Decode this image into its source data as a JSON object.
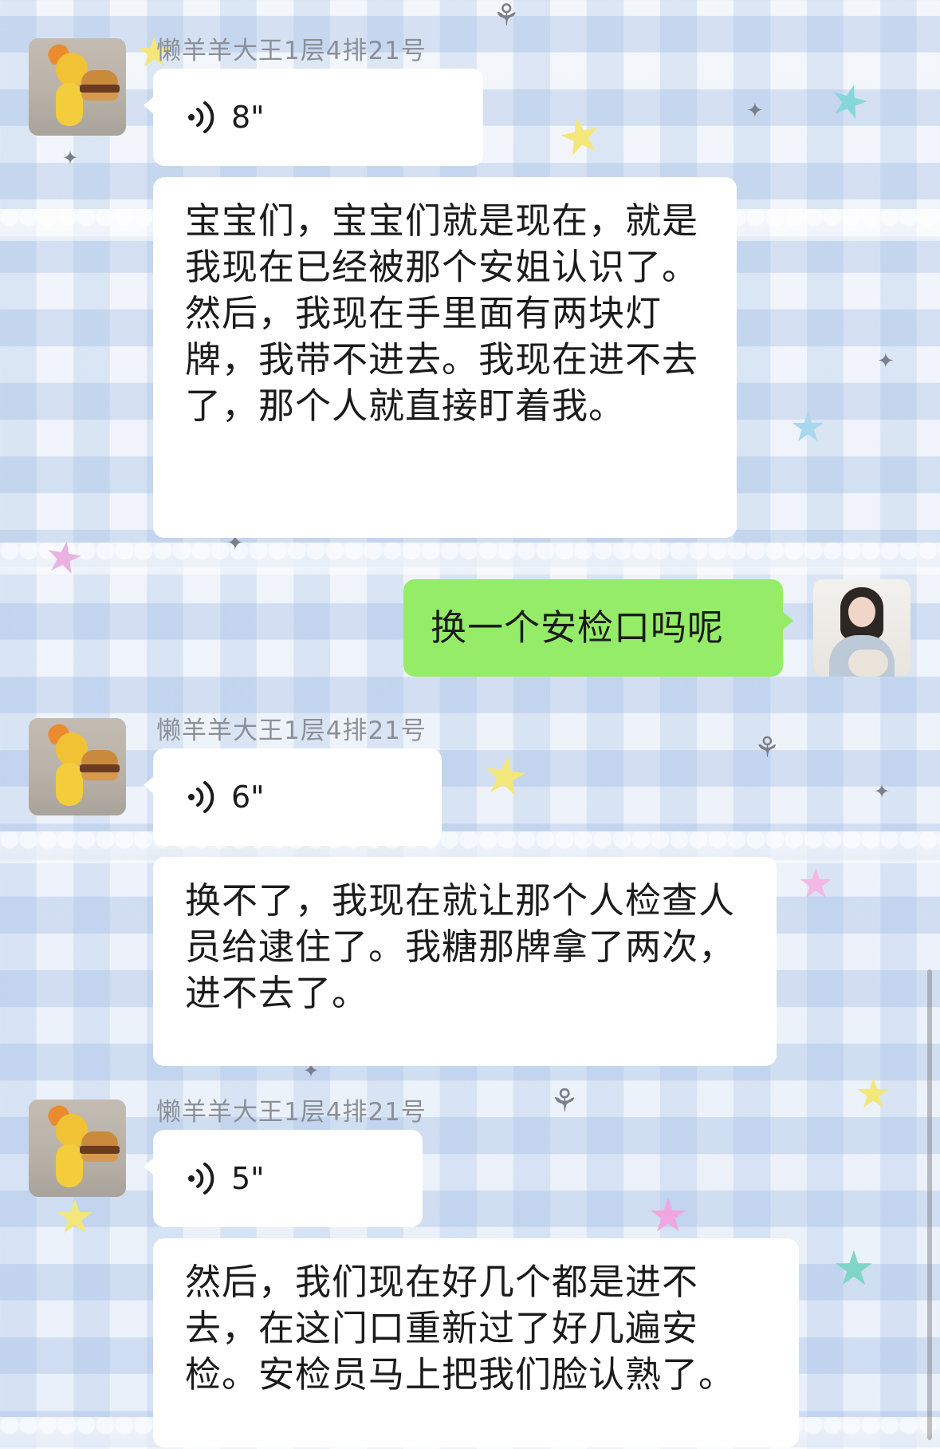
{
  "theme": {
    "self_bubble_color": "#95ec69",
    "other_bubble_color": "#ffffff",
    "name_color": "#8b8f97"
  },
  "messages": [
    {
      "sender": "懒羊羊大王1层4排21号",
      "voice_duration": "8\"",
      "transcript": "宝宝们，宝宝们就是现在，就是我现在已经被那个安姐认识了。然后，我现在手里面有两块灯牌，我带不进去。我现在进不去了，那个人就直接盯着我。"
    },
    {
      "self_text": "换一个安检口吗呢"
    },
    {
      "sender": "懒羊羊大王1层4排21号",
      "voice_duration": "6\"",
      "transcript": "换不了，我现在就让那个人检查人员给逮住了。我糖那牌拿了两次，进不去了。"
    },
    {
      "sender": "懒羊羊大王1层4排21号",
      "voice_duration": "5\"",
      "transcript": "然后，我们现在好几个都是进不去，在这门口重新过了好几遍安检。安检员马上把我们脸认熟了。"
    }
  ],
  "icons": {
    "voice": "voice-wave-icon",
    "sender_avatar": "garfield-burger-avatar",
    "self_avatar": "girl-photo-avatar"
  }
}
